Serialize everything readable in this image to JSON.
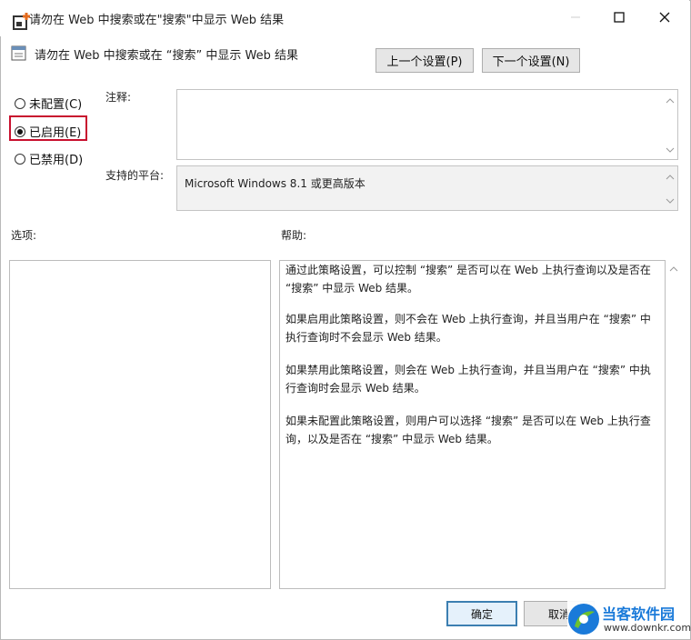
{
  "window": {
    "title": "请勿在 Web 中搜索或在\"搜索\"中显示 Web 结果",
    "subtitle": "请勿在 Web 中搜索或在 “搜索” 中显示 Web 结果"
  },
  "nav": {
    "prev_label": "上一个设置(P)",
    "next_label": "下一个设置(N)"
  },
  "state_options": [
    {
      "label": "未配置(C)",
      "selected": false
    },
    {
      "label": "已启用(E)",
      "selected": true
    },
    {
      "label": "已禁用(D)",
      "selected": false
    }
  ],
  "comment": {
    "label": "注释:",
    "value": ""
  },
  "platform": {
    "label": "支持的平台:",
    "value": "Microsoft Windows 8.1 或更高版本"
  },
  "options": {
    "label": "选项:"
  },
  "help": {
    "label": "帮助:",
    "paragraphs": [
      "通过此策略设置，可以控制 “搜索” 是否可以在 Web 上执行查询以及是否在 “搜索” 中显示 Web 结果。",
      "如果启用此策略设置，则不会在 Web 上执行查询，并且当用户在 “搜索” 中执行查询时不会显示 Web 结果。",
      "如果禁用此策略设置，则会在 Web 上执行查询，并且当用户在 “搜索” 中执行查询时会显示 Web 结果。",
      "如果未配置此策略设置，则用户可以选择 “搜索” 是否可以在 Web 上执行查询，以及是否在 “搜索” 中显示 Web 结果。"
    ]
  },
  "footer": {
    "ok_label": "确定",
    "cancel_label": "取消"
  },
  "watermark": {
    "name": "当客软件园",
    "url": "www.downkr.com"
  },
  "colors": {
    "highlight": "#c8102e",
    "default_button_border": "#3c7fb1",
    "watermark_blue": "#1a7ad9",
    "watermark_green": "#6cc12f"
  }
}
